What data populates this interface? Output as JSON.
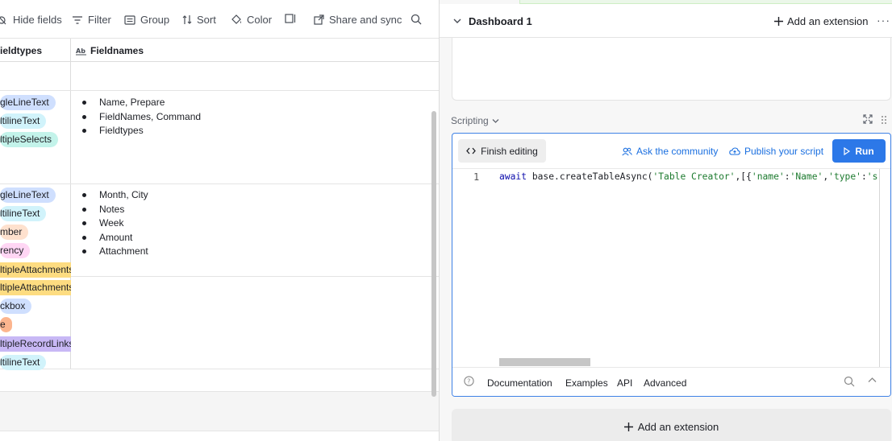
{
  "toolbar": {
    "hide_fields": "Hide fields",
    "filter": "Filter",
    "group": "Group",
    "sort": "Sort",
    "color": "Color",
    "share": "Share and sync"
  },
  "grid": {
    "col_fieldtypes": "ieldtypes",
    "col_fieldnames": "Fieldnames",
    "rows": [
      {
        "types": [
          {
            "label": "gleLineText",
            "color": "#cfdffe"
          },
          {
            "label": "ltilineText",
            "color": "#d1f3fb"
          },
          {
            "label": "ltipleSelects",
            "color": "#c3f3ea"
          }
        ],
        "names": [
          "Name, Prepare",
          "FieldNames, Command",
          "Fieldtypes"
        ]
      },
      {
        "types": [
          {
            "label": "gleLineText",
            "color": "#cfdffe"
          },
          {
            "label": "ltilineText",
            "color": "#d1f3fb"
          },
          {
            "label": "mber",
            "color": "#fee1ce"
          },
          {
            "label": "rency",
            "color": "#ffd6f4"
          },
          {
            "label": "ltipleAttachments",
            "color": "#fddc81"
          },
          {
            "label": "ltipleAttachments",
            "color": "#fddc81"
          },
          {
            "label": "ckbox",
            "color": "#cfdffe"
          },
          {
            "label": "e",
            "color": "#fcb58e"
          },
          {
            "label": "ltipleRecordLinks",
            "color": "#c8b8f5"
          },
          {
            "label": "ltilineText",
            "color": "#d1f3fb"
          }
        ],
        "names": [
          "Month, City",
          "Notes",
          "Week",
          "Amount",
          "Attachment"
        ]
      }
    ]
  },
  "dashboard": {
    "title": "Dashboard 1",
    "add_extension": "Add an extension",
    "more": "···"
  },
  "scripting": {
    "label": "Scripting",
    "finish_editing": "Finish editing",
    "ask_community": "Ask the community",
    "publish": "Publish your script",
    "run": "Run",
    "line_number": "1",
    "code": {
      "kw": "await",
      "p1": " base.createTableAsync(",
      "s1": "'Table Creator'",
      "p2": ",[{",
      "s2": "'name'",
      "p3": ":",
      "s3": "'Name'",
      "p4": ",",
      "s4": "'type'",
      "p5": ":",
      "s5": "'si"
    },
    "footer": {
      "documentation": "Documentation",
      "examples": "Examples",
      "api": "API",
      "advanced": "Advanced"
    }
  },
  "bottom_add_extension": "Add an extension"
}
